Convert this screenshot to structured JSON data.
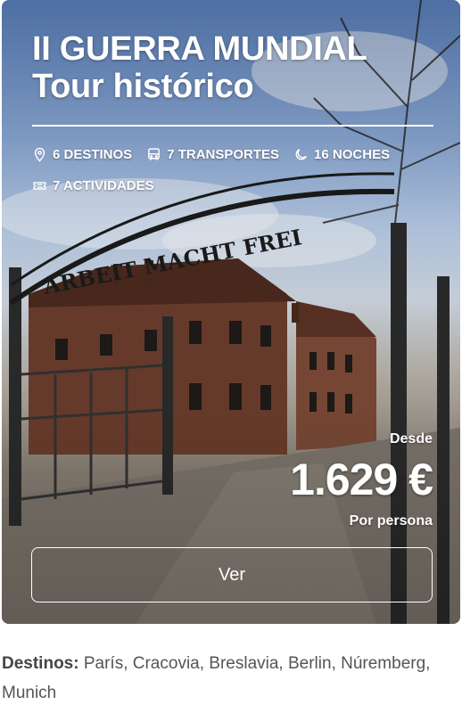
{
  "card": {
    "title_line1": "II GUERRA MUNDIAL",
    "title_line2": "Tour histórico",
    "meta": {
      "destinations": "6 DESTINOS",
      "transports": "7 TRANSPORTES",
      "nights": "16 NOCHES",
      "activities": "7 ACTIVIDADES"
    },
    "icons": [
      "location-pin-icon",
      "bus-icon",
      "moon-icon",
      "ticket-icon"
    ],
    "gate_sign": "ARBEIT MACHT FREI",
    "price": {
      "from_label": "Desde",
      "amount": "1.629 €",
      "per_label": "Por persona"
    },
    "cta_label": "Ver"
  },
  "destinations": {
    "label": "Destinos:",
    "list": "París, Cracovia, Breslavia, Berlin, Núremberg, Munich"
  }
}
